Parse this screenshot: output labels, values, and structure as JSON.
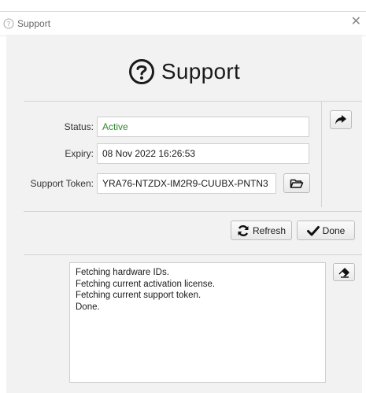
{
  "window": {
    "title": "Support",
    "icon": "support-help-icon"
  },
  "header": {
    "title": "Support",
    "icon": "question-circle-icon"
  },
  "form": {
    "status_label": "Status:",
    "status_value": "Active",
    "expiry_label": "Expiry:",
    "expiry_value": "08 Nov 2022 16:26:53",
    "token_label": "Support Token:",
    "token_value": "YRA76-NTZDX-IM2R9-CUUBX-PNTN3"
  },
  "buttons": {
    "refresh_label": "Refresh",
    "done_label": "Done",
    "forward_icon": "share-arrow-icon",
    "browse_icon": "folder-open-icon",
    "clear_icon": "eraser-icon"
  },
  "log": {
    "lines": [
      "Fetching hardware IDs.",
      "Fetching current activation license.",
      "Fetching current support token.",
      "Done."
    ]
  },
  "colors": {
    "status_active": "#2d8a2d",
    "background": "#f2f2f2"
  }
}
